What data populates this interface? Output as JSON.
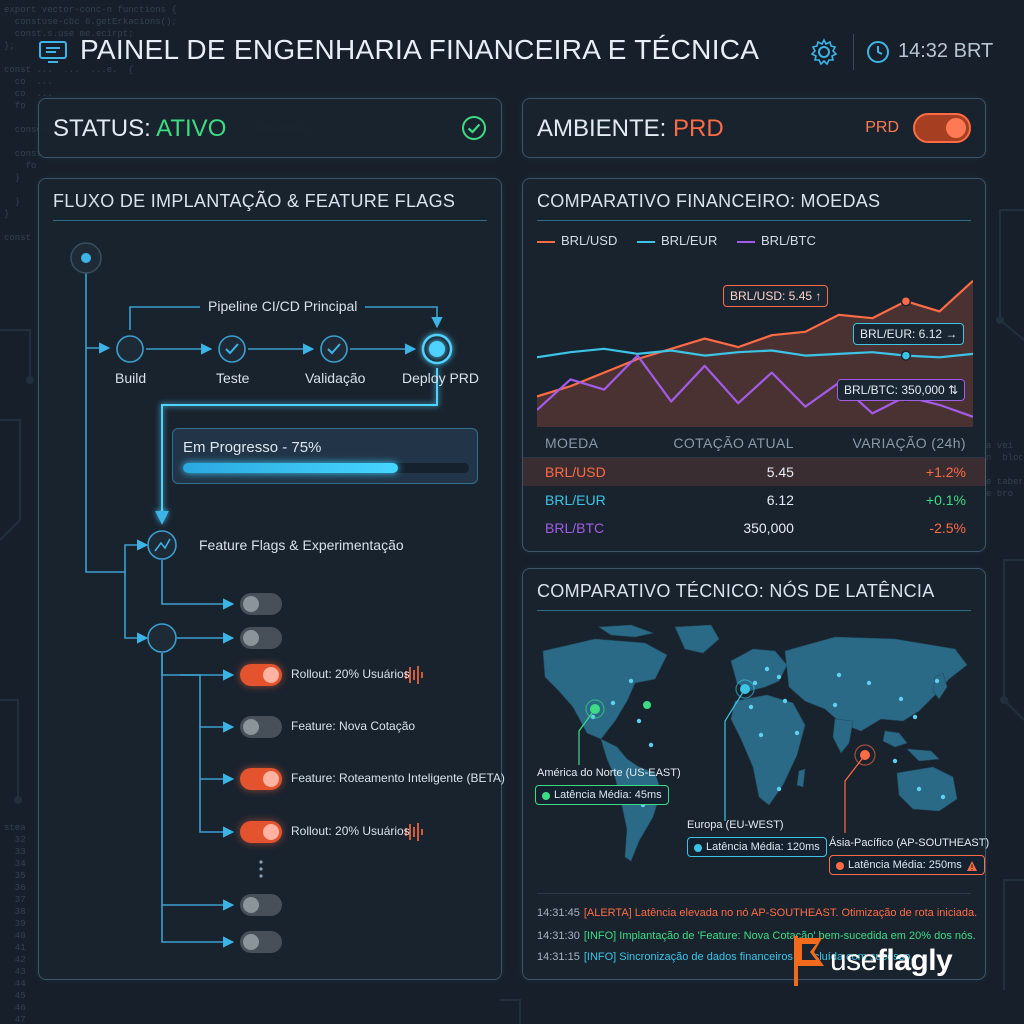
{
  "header": {
    "title": "PAINEL DE ENGENHARIA FINANCEIRA E TÉCNICA",
    "time": "14:32 BRT"
  },
  "status": {
    "label": "STATUS:",
    "value": "ATIVO"
  },
  "environment": {
    "label": "AMBIENTE:",
    "value": "PRD",
    "toggle_label": "PRD",
    "toggle_on": true
  },
  "flow": {
    "title": "FLUXO DE IMPLANTAÇÃO & FEATURE FLAGS",
    "pipeline_label": "Pipeline CI/CD Principal",
    "stages": [
      "Build",
      "Teste",
      "Validação",
      "Deploy PRD"
    ],
    "progress_label": "Em Progresso - 75%",
    "progress": 0.75,
    "flags_title": "Feature Flags & Experimentação",
    "flags": [
      {
        "label": "",
        "on": false
      },
      {
        "label": "",
        "on": false
      },
      {
        "label": "Rollout: 20% Usuários",
        "on": true
      },
      {
        "label": "Feature: Nova Cotação",
        "on": false
      },
      {
        "label": "Feature: Roteamento Inteligente (BETA)",
        "on": true
      },
      {
        "label": "Rollout: 20% Usuários",
        "on": true
      },
      {
        "label": "",
        "on": false
      },
      {
        "label": "",
        "on": false
      }
    ]
  },
  "finance": {
    "title": "COMPARATIVO FINANCEIRO: MOEDAS",
    "legend": [
      "BRL/USD",
      "BRL/EUR",
      "BRL/BTC"
    ],
    "callouts": {
      "usd": "BRL/USD: 5.45 ↑",
      "eur": "BRL/EUR: 6.12 →",
      "btc": "BRL/BTC: 350,000 ⇅"
    },
    "table": {
      "headers": [
        "MOEDA",
        "COTAÇÃO ATUAL",
        "VARIAÇÃO (24h)"
      ],
      "rows": [
        {
          "pair": "BRL/USD",
          "quote": "5.45",
          "change": "+1.2%"
        },
        {
          "pair": "BRL/EUR",
          "quote": "6.12",
          "change": "+0.1%"
        },
        {
          "pair": "BRL/BTC",
          "quote": "350,000",
          "change": "-2.5%"
        }
      ]
    }
  },
  "chart_data": {
    "type": "line",
    "title": "COMPARATIVO FINANCEIRO: MOEDAS",
    "xlabel": "",
    "ylabel": "",
    "grid": false,
    "legend_position": "top-left",
    "series": [
      {
        "name": "BRL/USD",
        "color": "#ff6b45",
        "values": [
          0.18,
          0.24,
          0.32,
          0.4,
          0.46,
          0.52,
          0.47,
          0.54,
          0.56,
          0.66,
          0.64,
          0.74,
          0.68,
          0.86
        ]
      },
      {
        "name": "BRL/EUR",
        "color": "#3cc4e6",
        "values": [
          0.41,
          0.44,
          0.46,
          0.43,
          0.45,
          0.42,
          0.44,
          0.45,
          0.42,
          0.43,
          0.44,
          0.42,
          0.41,
          0.43
        ]
      },
      {
        "name": "BRL/BTC",
        "color": "#a35ce8",
        "values": [
          0.1,
          0.28,
          0.22,
          0.42,
          0.15,
          0.36,
          0.14,
          0.32,
          0.12,
          0.26,
          0.08,
          0.18,
          0.13,
          0.06
        ]
      }
    ]
  },
  "latency": {
    "title": "COMPARATIVO TÉCNICO: NÓS DE LATÊNCIA",
    "regions": [
      {
        "name": "América do Norte (US-EAST)",
        "latency": "Latência Média: 45ms",
        "color": "#3ddc84"
      },
      {
        "name": "Europa (EU-WEST)",
        "latency": "Latência Média: 120ms",
        "color": "#3cc4e6"
      },
      {
        "name": "Ásia-Pacífico (AP-SOUTHEAST)",
        "latency": "Latência Média: 250ms",
        "color": "#ff6b45"
      }
    ],
    "logs": [
      {
        "time": "14:31:45",
        "text": "[ALERTA] Latência elevada no nó AP-SOUTHEAST. Otimização de rota iniciada.",
        "color": "#ff6b45"
      },
      {
        "time": "14:31:30",
        "text": "[INFO] Implantação de 'Feature: Nova Cotação' bem-sucedida em 20% dos nós.",
        "color": "#3ddc84"
      },
      {
        "time": "14:31:15",
        "text": "[INFO] Sincronização de dados financeiros concluída com sucesso.",
        "color": "#3cc4e6"
      }
    ]
  },
  "brand": {
    "prefix": "use",
    "name": "flagly"
  }
}
